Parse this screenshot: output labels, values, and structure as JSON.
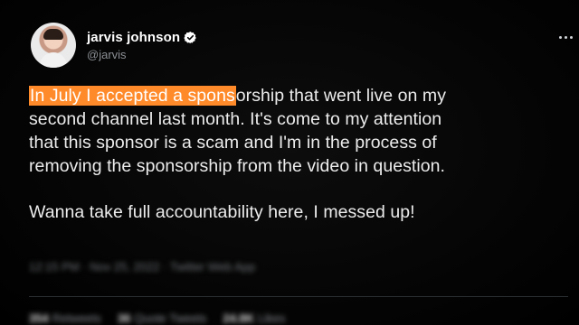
{
  "author": {
    "display_name": "jarvis johnson",
    "handle": "@jarvis",
    "verified": true,
    "avatar_icon": "profile-photo"
  },
  "tweet": {
    "highlight": "In July I accepted a spons",
    "line1_rest": "orship that went live on my",
    "line2": "second channel last month. It's come to my attention",
    "line3": "that this sponsor is a scam and I'm in the process of",
    "line4": "removing the sponsorship from the video in question.",
    "line5": "Wanna take full accountability here, I messed up!"
  },
  "meta": {
    "timestamp": "12:15 PM · Nov 25, 2022 · Twitter Web App"
  },
  "stats": {
    "retweets_count": "354",
    "retweets_label": "Retweets",
    "quotes_count": "36",
    "quotes_label": "Quote Tweets",
    "likes_count": "24.8K",
    "likes_label": "Likes"
  },
  "colors": {
    "highlight": "#ff8a2a",
    "background": "#000000",
    "verified_badge": "#ffffff"
  }
}
